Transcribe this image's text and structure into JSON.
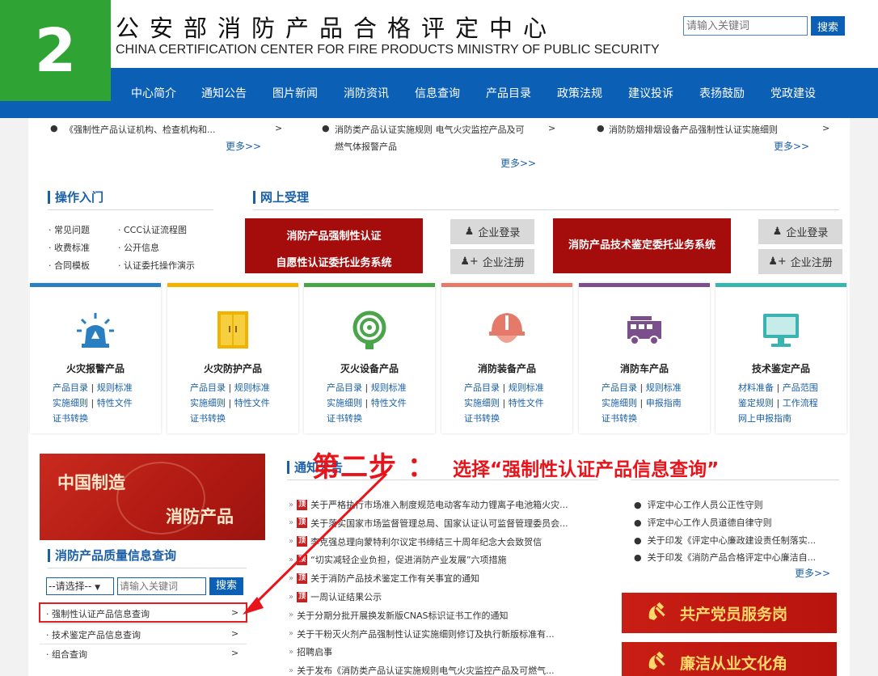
{
  "step_badge": "2",
  "header": {
    "title_cn": "公安部消防产品合格评定中心",
    "title_en": "CHINA CERTIFICATION CENTER FOR FIRE PRODUCTS MINISTRY OF PUBLIC SECURITY",
    "search_placeholder": "请输入关键词",
    "search_button": "搜索"
  },
  "nav": [
    "中心简介",
    "通知公告",
    "图片新闻",
    "消防资讯",
    "信息查询",
    "产品目录",
    "政策法规",
    "建议投诉",
    "表扬鼓励",
    "党政建设"
  ],
  "top_lists": {
    "col1": {
      "item": "《强制性产品认证机构、检查机构和...",
      "arrow": ">",
      "more": "更多>>"
    },
    "col2": {
      "item_l1": "消防类产品认证实施规则 电气火灾监控产品及可",
      "item_l2": "燃气体报警产品",
      "arrow": ">",
      "more": "更多>>"
    },
    "col3": {
      "item": "消防防烟排烟设备产品强制性认证实施细则",
      "arrow": ">",
      "more": "更多>>"
    }
  },
  "operation": {
    "title": "操作入门",
    "links": [
      "· 常见问题",
      "· CCC认证流程图",
      "· 收费标准",
      "· 公开信息",
      "· 合同模板",
      "· 认证委托操作演示"
    ]
  },
  "online": {
    "title": "网上受理",
    "system1_l1": "消防产品强制性认证",
    "system1_l2": "自愿性认证委托业务系统",
    "system2": "消防产品技术鉴定委托业务系统",
    "login": "企业登录",
    "register": "企业注册"
  },
  "cards": [
    {
      "title": "火灾报警产品",
      "color": "#2a7fc1",
      "links": [
        [
          "产品目录",
          "规则标准"
        ],
        [
          "实施细则",
          "特性文件"
        ],
        [
          "证书转换"
        ]
      ]
    },
    {
      "title": "火灾防护产品",
      "color": "#f0b400",
      "links": [
        [
          "产品目录",
          "规则标准"
        ],
        [
          "实施细则",
          "特性文件"
        ],
        [
          "证书转换"
        ]
      ]
    },
    {
      "title": "灭火设备产品",
      "color": "#4aa54a",
      "links": [
        [
          "产品目录",
          "规则标准"
        ],
        [
          "实施细则",
          "特性文件"
        ],
        [
          "证书转换"
        ]
      ]
    },
    {
      "title": "消防装备产品",
      "color": "#e57a6a",
      "links": [
        [
          "产品目录",
          "规则标准"
        ],
        [
          "实施细则",
          "特性文件"
        ],
        [
          "证书转换"
        ]
      ]
    },
    {
      "title": "消防车产品",
      "color": "#7b4f8c",
      "links": [
        [
          "产品目录",
          "规则标准"
        ],
        [
          "实施细则",
          "申报指南"
        ],
        [
          "证书转换"
        ]
      ]
    },
    {
      "title": "技术鉴定产品",
      "color": "#3bb3b0",
      "links": [
        [
          "材料准备",
          "产品范围"
        ],
        [
          "鉴定规则",
          "工作流程"
        ],
        [
          "网上申报指南"
        ]
      ]
    }
  ],
  "banner": {
    "line1": "中国制造",
    "line2": "消防产品"
  },
  "quality": {
    "title": "消防产品质量信息查询",
    "select": "--请选择--",
    "input_placeholder": "请输入关键词",
    "search_button": "搜索",
    "items": [
      "· 强制性认证产品信息查询",
      "· 技术鉴定产品信息查询",
      "· 组合查询"
    ],
    "arrow": ">"
  },
  "notice": {
    "title": "通知公告",
    "ding": "顶",
    "items": [
      {
        "text": "关于严格执行市场准入制度规范电动客车动力锂离子电池箱火灾...",
        "top": true
      },
      {
        "text": "关于落实国家市场监督管理总局、国家认证认可监督管理委员会...",
        "top": true
      },
      {
        "text": "李克强总理向蒙特利尔议定书缔结三十周年纪念大会致贺信",
        "top": true
      },
      {
        "text": "“切实减轻企业负担，促进消防产业发展”六项措施",
        "top": true
      },
      {
        "text": "关于消防产品技术鉴定工作有关事宜的通知",
        "top": true
      },
      {
        "text": "一周认证结果公示",
        "top": true
      },
      {
        "text": "关于分期分批开展换发新版CNAS标识证书工作的通知",
        "top": false
      },
      {
        "text": "关于干粉灭火剂产品强制性认证实施细则修订及执行新版标准有...",
        "top": false
      },
      {
        "text": "招聘启事",
        "top": false
      },
      {
        "text": "关于发布《消防类产品认证实施规则电气火灾监控产品及可燃气...",
        "top": false
      }
    ]
  },
  "right_news": {
    "items": [
      "评定中心工作人员公正性守则",
      "评定中心工作人员道德自律守则",
      "关于印发《评定中心廉政建设责任制落实...",
      "关于印发《消防产品合格评定中心廉洁自..."
    ],
    "more": "更多>>"
  },
  "party": [
    "共产党员服务岗",
    "廉洁从业文化角"
  ],
  "annotation": {
    "main": "第二步 ：",
    "sub": "选择“强制性认证产品信息查询”"
  }
}
